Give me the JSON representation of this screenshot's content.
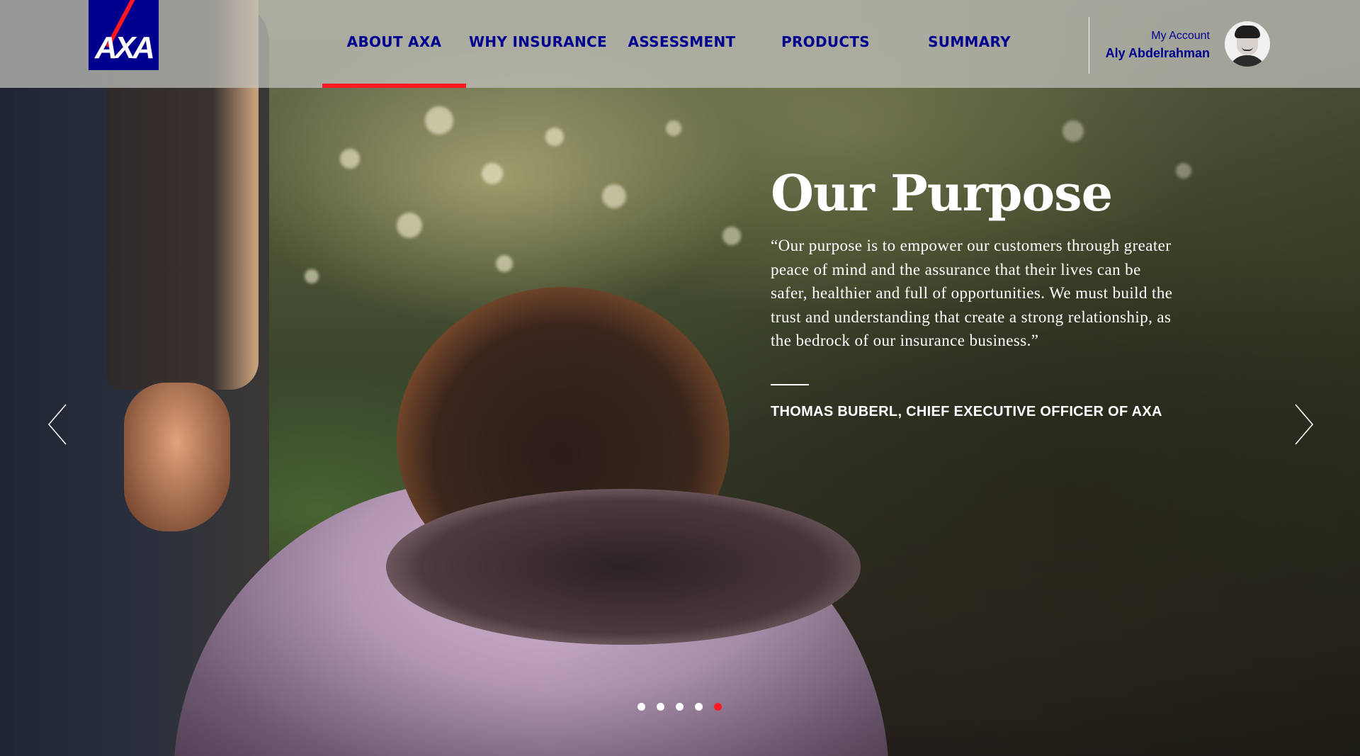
{
  "header": {
    "logo_text": "AXA",
    "nav": [
      {
        "label": "ABOUT AXA",
        "active": true
      },
      {
        "label": "WHY INSURANCE",
        "active": false
      },
      {
        "label": "ASSESSMENT",
        "active": false
      },
      {
        "label": "PRODUCTS",
        "active": false
      },
      {
        "label": "SUMMARY",
        "active": false
      }
    ],
    "account": {
      "label": "My Account",
      "name": "Aly Abdelrahman",
      "avatar_icon": "user-avatar-icon"
    }
  },
  "hero": {
    "title": "Our Purpose",
    "quote": "“Our purpose is to empower our customers through greater peace of mind and the assurance that their lives can be safer, healthier and full of opportunities. We must build the trust and understanding that create a strong relationship, as the bedrock of our insurance business.”",
    "author": "THOMAS BUBERL, CHIEF EXECUTIVE OFFICER OF AXA",
    "prev_icon": "chevron-left-icon",
    "next_icon": "chevron-right-icon"
  },
  "carousel": {
    "slide_count": 5,
    "active_index": 4
  },
  "colors": {
    "brand_blue": "#00008f",
    "accent_red": "#ff1721",
    "text_white": "#ffffff"
  }
}
